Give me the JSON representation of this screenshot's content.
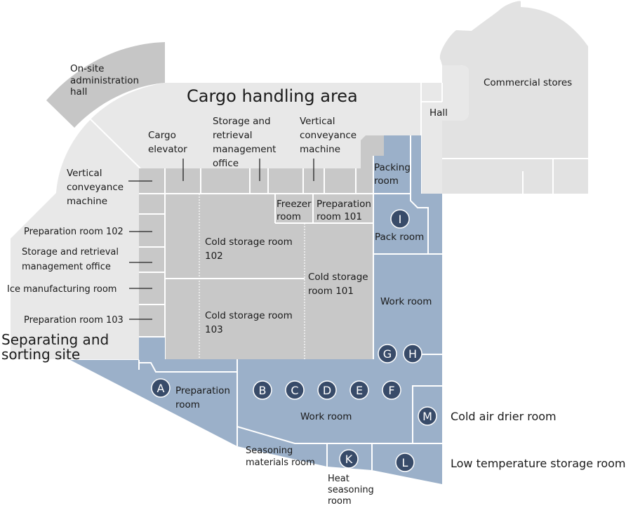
{
  "colors": {
    "light_area": "#e8e8e8",
    "storage_gray": "#c8c8c8",
    "work_blue": "#9bb0c9",
    "marker": "#384b69",
    "admin_hall": "#c6c6c6",
    "stores": "#e2e2e2"
  },
  "areas": {
    "admin_hall": [
      "On-site",
      "administration",
      "hall"
    ],
    "cargo_area": "Cargo handling area",
    "separating": [
      "Separating and",
      "sorting site"
    ],
    "commercial": "Commercial stores",
    "hall": "Hall"
  },
  "rooms": {
    "cargo_elevator": [
      "Cargo",
      "elevator"
    ],
    "srmo_top": [
      "Storage and",
      "retrieval",
      "management",
      "office"
    ],
    "vcm_top": [
      "Vertical",
      "conveyance",
      "machine"
    ],
    "vcm_left": [
      "Vertical",
      "conveyance",
      "machine"
    ],
    "prep102": "Preparation room 102",
    "srmo_left": [
      "Storage and retrieval",
      "management office"
    ],
    "ice": "Ice manufacturing room",
    "prep103": "Preparation room 103",
    "freezer": [
      "Freezer",
      "room"
    ],
    "prep101": [
      "Preparation",
      "room 101"
    ],
    "packing": [
      "Packing",
      "room"
    ],
    "pack": "Pack room",
    "cold102": [
      "Cold storage room",
      "102"
    ],
    "cold101": [
      "Cold storage",
      "room 101"
    ],
    "cold103": [
      "Cold storage room",
      "103"
    ],
    "work_right": "Work room",
    "prep_room": [
      "Preparation",
      "room"
    ],
    "work_main": "Work room",
    "seasoning": [
      "Seasoning",
      "materials room"
    ],
    "heat": [
      "Heat",
      "seasoning",
      "room"
    ],
    "cold_air": "Cold air drier room",
    "low_temp": "Low temperature storage room"
  },
  "markers": [
    "A",
    "B",
    "C",
    "D",
    "E",
    "F",
    "G",
    "H",
    "I",
    "K",
    "L",
    "M"
  ]
}
